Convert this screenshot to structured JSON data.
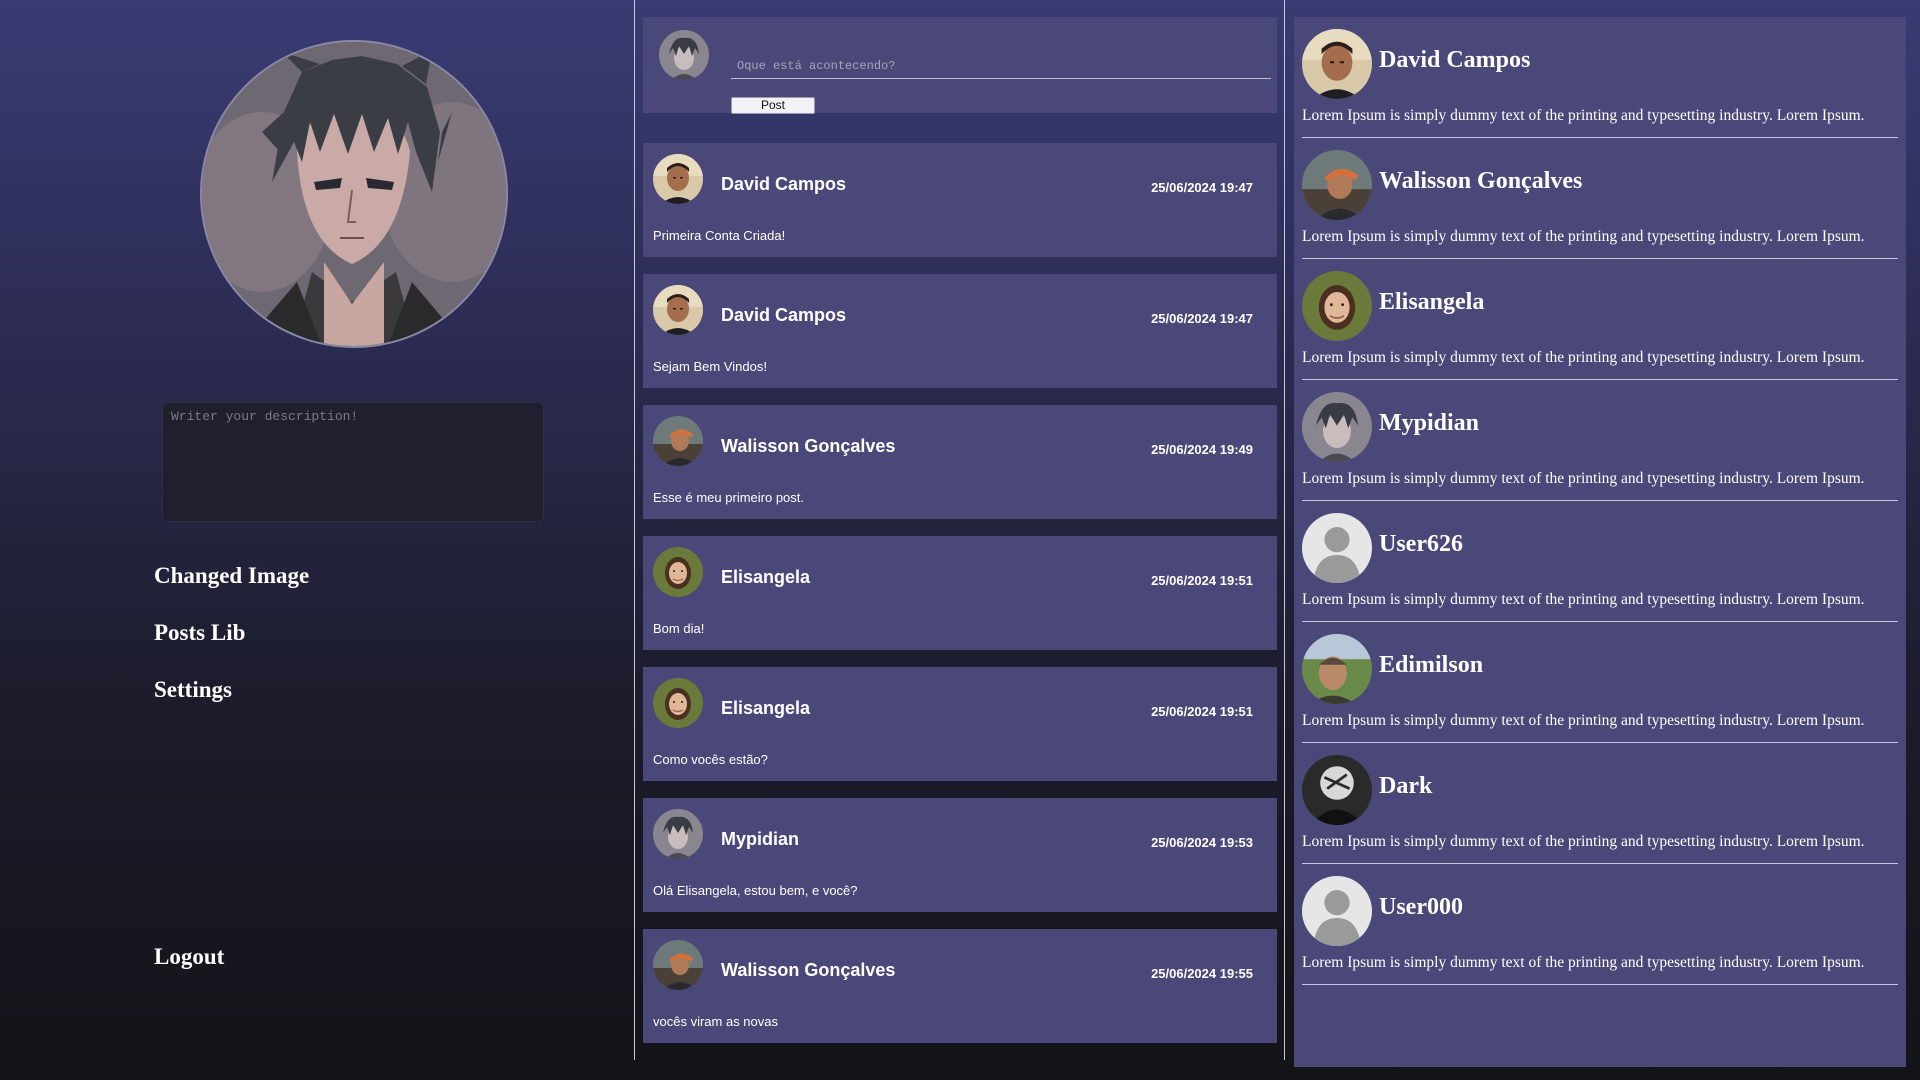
{
  "sidebar": {
    "description_placeholder": "Writer your description!",
    "nav": {
      "changed_image": "Changed Image",
      "posts_lib": "Posts Lib",
      "settings": "Settings",
      "logout": "Logout"
    }
  },
  "composer": {
    "placeholder": "Oque está acontecendo?",
    "post_label": "Post"
  },
  "posts": [
    {
      "author": "David Campos",
      "time": "25/06/2024 19:47",
      "text": "Primeira Conta Criada!"
    },
    {
      "author": "David Campos",
      "time": "25/06/2024 19:47",
      "text": "Sejam Bem Vindos!"
    },
    {
      "author": "Walisson Gonçalves",
      "time": "25/06/2024 19:49",
      "text": "Esse é meu primeiro post."
    },
    {
      "author": "Elisangela",
      "time": "25/06/2024 19:51",
      "text": "Bom dia!"
    },
    {
      "author": "Elisangela",
      "time": "25/06/2024 19:51",
      "text": "Como vocês estão?"
    },
    {
      "author": "Mypidian",
      "time": "25/06/2024 19:53",
      "text": "Olá Elisangela, estou bem, e você?"
    },
    {
      "author": "Walisson Gonçalves",
      "time": "25/06/2024 19:55",
      "text": "vocês viram as novas"
    }
  ],
  "users": [
    {
      "name": "David Campos",
      "desc": "Lorem Ipsum is simply dummy text of the printing and typesetting industry. Lorem Ipsum."
    },
    {
      "name": "Walisson Gonçalves",
      "desc": "Lorem Ipsum is simply dummy text of the printing and typesetting industry. Lorem Ipsum."
    },
    {
      "name": "Elisangela",
      "desc": "Lorem Ipsum is simply dummy text of the printing and typesetting industry. Lorem Ipsum."
    },
    {
      "name": "Mypidian",
      "desc": "Lorem Ipsum is simply dummy text of the printing and typesetting industry. Lorem Ipsum."
    },
    {
      "name": "User626",
      "desc": "Lorem Ipsum is simply dummy text of the printing and typesetting industry. Lorem Ipsum."
    },
    {
      "name": "Edimilson",
      "desc": "Lorem Ipsum is simply dummy text of the printing and typesetting industry. Lorem Ipsum."
    },
    {
      "name": "Dark",
      "desc": "Lorem Ipsum is simply dummy text of the printing and typesetting industry. Lorem Ipsum."
    },
    {
      "name": "User000",
      "desc": "Lorem Ipsum is simply dummy text of the printing and typesetting industry. Lorem Ipsum."
    }
  ],
  "colors": {
    "panel": "#4a4878",
    "background_top": "#3a3b74",
    "background_bottom": "#131318",
    "text": "#ffffff"
  }
}
